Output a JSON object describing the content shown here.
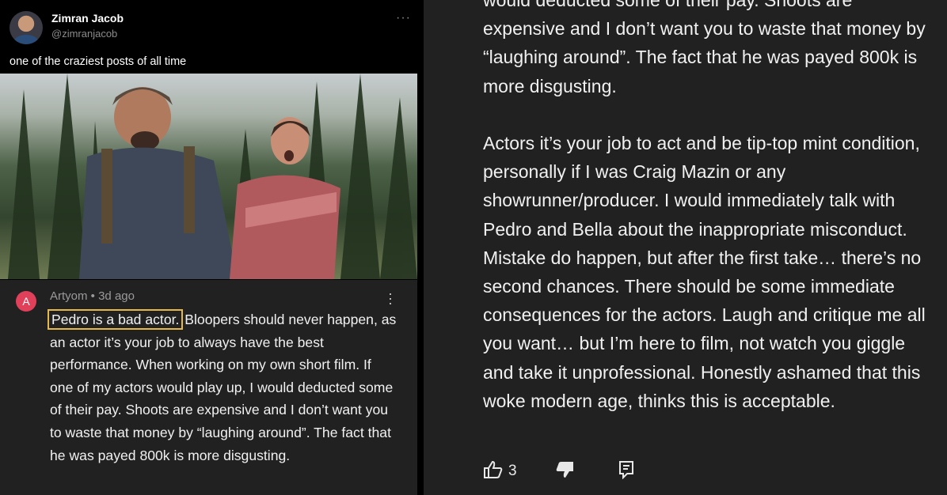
{
  "post": {
    "author_name": "Zimran Jacob",
    "author_handle": "@zimranjacob",
    "more_label": "···",
    "text": "one of the craziest posts of all time"
  },
  "comment": {
    "avatar_letter": "A",
    "meta": "Artyom • 3d ago",
    "highlighted_sentence": "Pedro is a bad actor.",
    "left_rest": " Bloopers should never happen, as an actor it’s your job to always have the best performance. When working on my own short film. If one of my actors would play up, I would deducted some of their pay. Shoots are expensive and I don’t want you to waste that money by “laughing around”. The fact that he was payed 800k is more disgusting.",
    "right_para1": "would deducted some of their pay. Shoots are expensive and I don’t want you to waste that money by “laughing around”. The fact that he was payed 800k is more disgusting.",
    "right_para2": "Actors it’s your job to act and be tip-top mint condition, personally if I was Craig Mazin or any showrunner/producer. I would immediately talk with Pedro and Bella about the inappropriate misconduct. Mistake do happen, but after the first take… there’s no second chances. There should be some immediate consequences for the actors. Laugh and critique me all you want… but I’m here to film, not watch you giggle and take it unprofessional. Honestly ashamed that this woke modern age, thinks this is acceptable.",
    "like_count": "3",
    "icons": [
      "thumb-up-icon",
      "thumb-down-icon",
      "reply-icon"
    ],
    "highlight_color": "#e5b84a",
    "avatar_color": "#e1405a"
  }
}
